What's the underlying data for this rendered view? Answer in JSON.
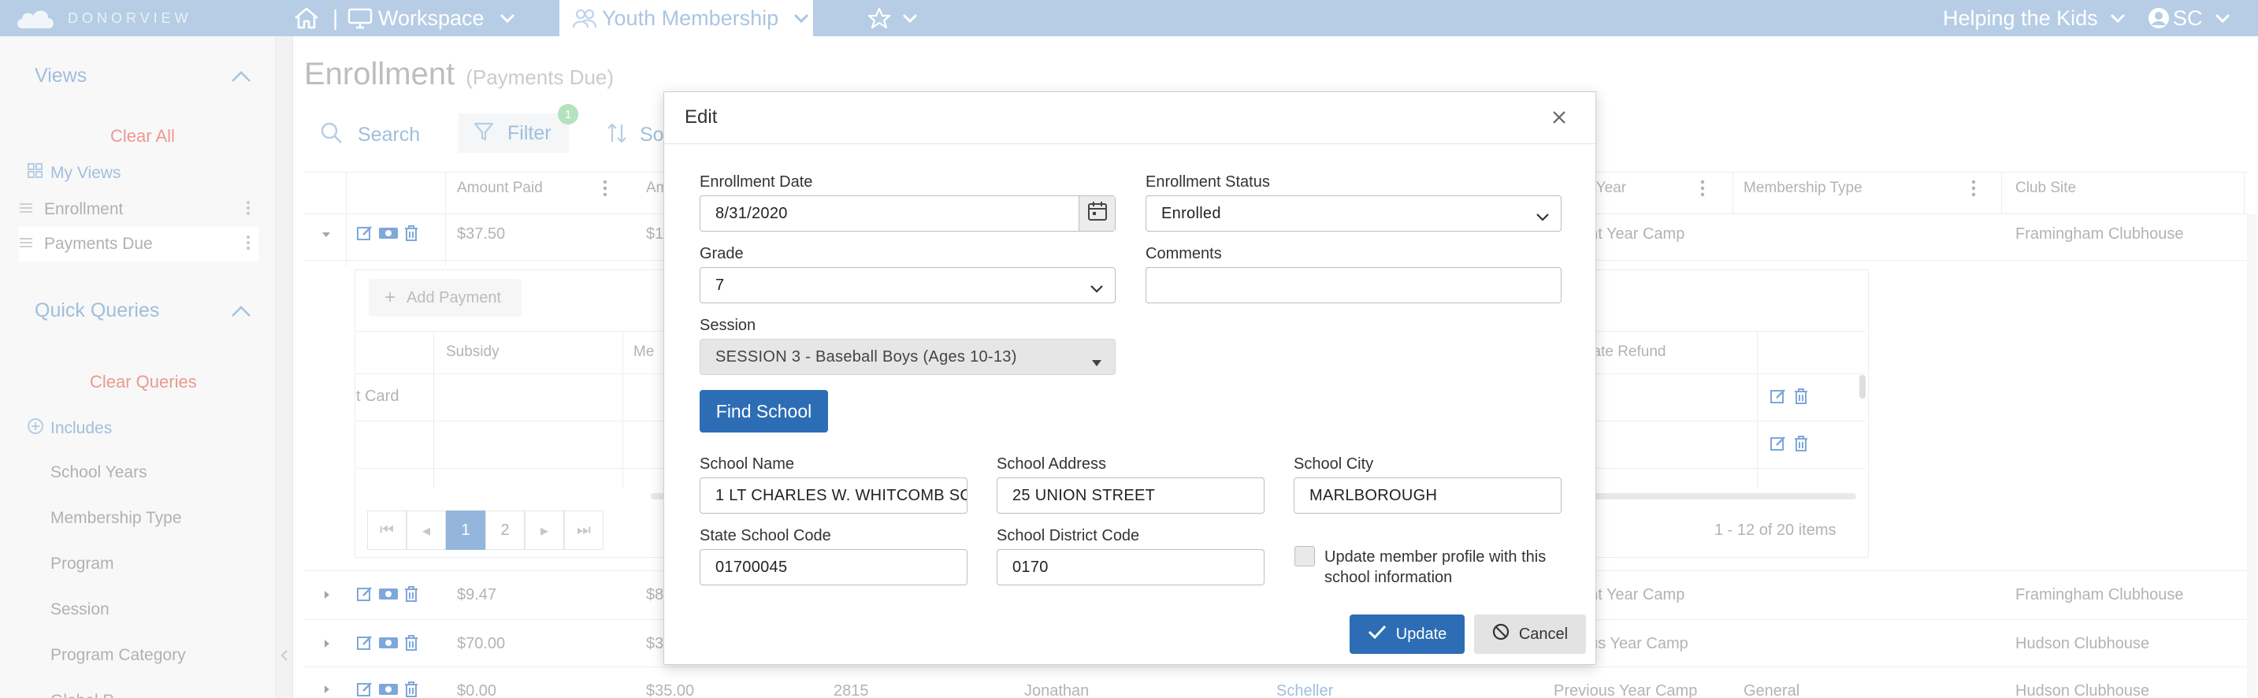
{
  "colors": {
    "topbar": "#8fb3d8",
    "accent": "#2d6db5",
    "link": "#6e9ccb",
    "danger_text": "#e06358",
    "badge": "#8cd39b"
  },
  "topbar": {
    "brand": "DONORVIEW",
    "workspace_label": "Workspace",
    "module_label": "Youth Membership",
    "org_label": "Helping the Kids",
    "user_initials": "SC",
    "icons": [
      "home-icon",
      "monitor-icon",
      "users-icon",
      "star-icon",
      "chevron-down-icon",
      "user-circle-icon"
    ]
  },
  "sidebar": {
    "views_title": "Views",
    "clear_all": "Clear All",
    "my_views": "My Views",
    "view_items": [
      "Enrollment",
      "Payments Due"
    ],
    "quick_queries_title": "Quick Queries",
    "clear_queries": "Clear Queries",
    "includes": "Includes",
    "query_items": [
      "School Years",
      "Membership Type",
      "Program",
      "Session",
      "Program Category",
      "Global P..."
    ]
  },
  "page": {
    "title": "Enrollment",
    "subtitle": "(Payments Due)",
    "search_label": "Search",
    "filter_label": "Filter",
    "filter_count": "1",
    "sort_label": "So"
  },
  "grid": {
    "columns": [
      "Amount Paid",
      "Am",
      "ol Year",
      "Membership Type",
      "Club Site"
    ],
    "rows": [
      {
        "amount_paid": "$37.50",
        "am": "$1",
        "year": "ent Year Camp",
        "membership_type": "",
        "club_site": "Framingham Clubhouse"
      },
      {
        "amount_paid": "$9.47",
        "am": "$8",
        "year": "ent Year Camp",
        "membership_type": "",
        "club_site": "Framingham Clubhouse"
      },
      {
        "amount_paid": "$70.00",
        "am": "$3",
        "year": "ous Year Camp",
        "membership_type": "",
        "club_site": "Hudson Clubhouse"
      },
      {
        "amount_paid": "$0.00",
        "am": "$35.00",
        "id": "2815",
        "first": "Jonathan",
        "last": "Scheller",
        "year": "Previous Year Camp",
        "membership_type": "General",
        "club_site": "Hudson Clubhouse"
      }
    ],
    "detail": {
      "add_payment": "Add Payment",
      "columns": [
        "Subsidy",
        "Me",
        "tiate Refund"
      ],
      "first_cell": "t Card",
      "pages": [
        "1",
        "2"
      ],
      "items_info": "1 - 12 of 20 items"
    }
  },
  "modal": {
    "title": "Edit",
    "enrollment_date_label": "Enrollment Date",
    "enrollment_date": "8/31/2020",
    "enrollment_status_label": "Enrollment Status",
    "enrollment_status": "Enrolled",
    "grade_label": "Grade",
    "grade": "7",
    "comments_label": "Comments",
    "comments": "",
    "session_label": "Session",
    "session": "SESSION 3 - Baseball Boys (Ages 10-13)",
    "find_school": "Find School",
    "school_name_label": "School Name",
    "school_name": "1 LT CHARLES W. WHITCOMB SC",
    "school_address_label": "School Address",
    "school_address": "25 UNION STREET",
    "school_city_label": "School City",
    "school_city": "MARLBOROUGH",
    "state_code_label": "State School Code",
    "state_code": "01700045",
    "district_code_label": "School District Code",
    "district_code": "0170",
    "update_profile_label": "Update member profile with this school information",
    "update_profile_checked": false,
    "update_button": "Update",
    "cancel_button": "Cancel"
  }
}
